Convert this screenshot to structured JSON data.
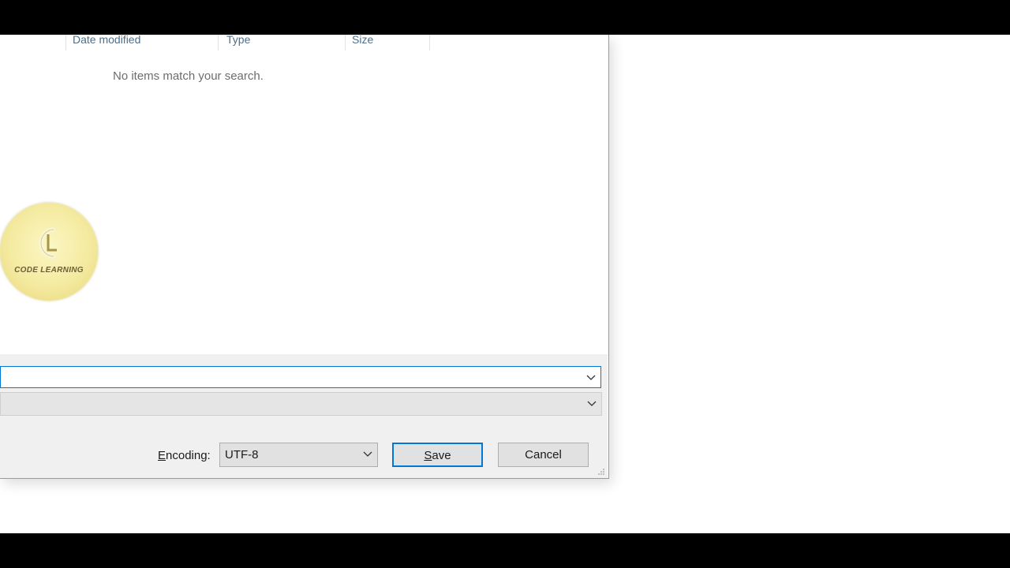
{
  "columns": {
    "date_modified": "Date modified",
    "type": "Type",
    "size": "Size"
  },
  "file_list": {
    "empty_message": "No items match your search."
  },
  "watermark": {
    "text": "CODE LEARNING",
    "mark": "CL"
  },
  "fields": {
    "file_name_value": "",
    "save_as_type_value": ""
  },
  "encoding": {
    "label_prefix": "E",
    "label_rest": "ncoding:",
    "value": "UTF-8"
  },
  "buttons": {
    "save_prefix": "S",
    "save_rest": "ave",
    "cancel": "Cancel"
  },
  "icons": {
    "chevron": "chevron-down-icon",
    "grip": "resize-grip-icon"
  },
  "colors": {
    "focus_blue": "#0078d7",
    "panel_gray": "#f0f0f0",
    "watermark_gold": "#f4eaa0"
  }
}
